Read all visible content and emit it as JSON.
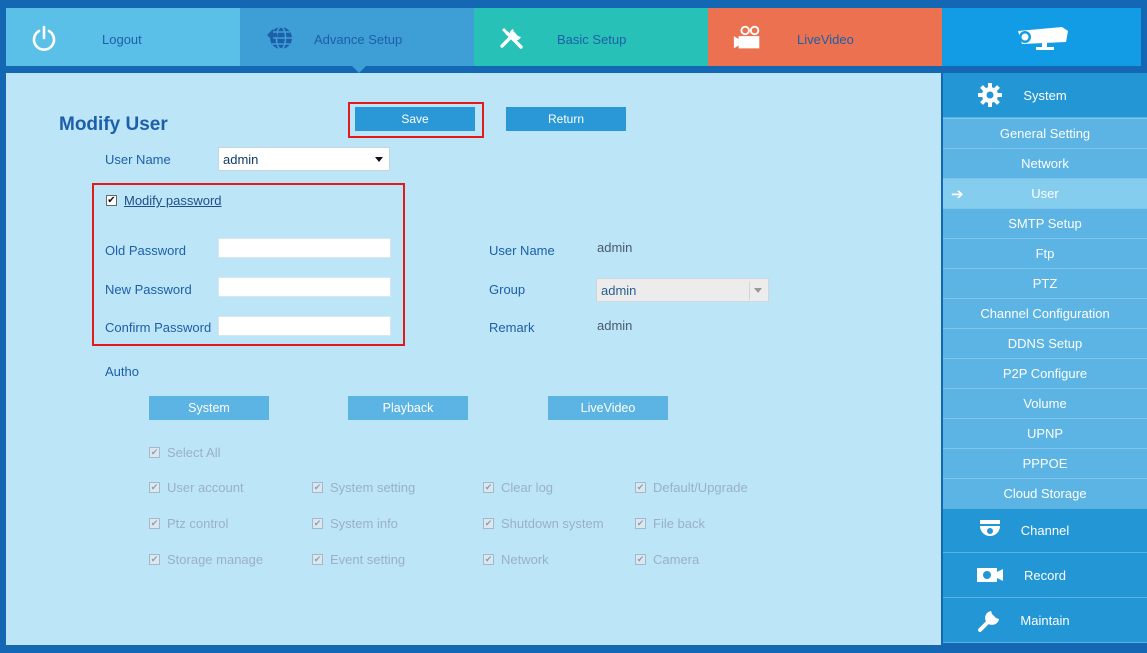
{
  "topnav": {
    "tabs": [
      {
        "label": "Logout",
        "icon": "power-icon",
        "color": "#5bc0e8"
      },
      {
        "label": "Advance Setup",
        "icon": "globe-icon",
        "color": "#3d9fd6"
      },
      {
        "label": "Basic Setup",
        "icon": "tools-icon",
        "color": "#27c1b8"
      },
      {
        "label": "LiveVideo",
        "icon": "video-camera-icon",
        "color": "#ec7150"
      }
    ],
    "logo_icon": "security-camera-icon"
  },
  "page": {
    "title": "Modify User",
    "save_label": "Save",
    "return_label": "Return",
    "username_label": "User Name",
    "username_value": "admin",
    "modify_password_label": "Modify password",
    "modify_password_checked": true,
    "old_password_label": "Old Password",
    "new_password_label": "New Password",
    "confirm_password_label": "Confirm Password",
    "old_password_value": "",
    "new_password_value": "",
    "confirm_password_value": "",
    "info": {
      "user_name_label": "User Name",
      "user_name_value": "admin",
      "group_label": "Group",
      "group_value": "admin",
      "remark_label": "Remark",
      "remark_value": "admin"
    },
    "autho_label": "Autho",
    "autho_tabs": [
      "System",
      "Playback",
      "LiveVideo"
    ],
    "select_all_label": "Select All",
    "permissions": [
      [
        "User account",
        "System setting",
        "Clear log",
        "Default/Upgrade"
      ],
      [
        "Ptz control",
        "System info",
        "Shutdown system",
        "File back"
      ],
      [
        "Storage manage",
        "Event setting",
        "Network",
        "Camera"
      ]
    ],
    "highlight_color": "#e11b1b"
  },
  "sidebar": {
    "system_label": "System",
    "items": [
      "General Setting",
      "Network",
      "User",
      "SMTP Setup",
      "Ftp",
      "PTZ",
      "Channel Configuration",
      "DDNS Setup",
      "P2P Configure",
      "Volume",
      "UPNP",
      "PPPOE",
      "Cloud Storage"
    ],
    "active_item": "User",
    "channel_label": "Channel",
    "record_label": "Record",
    "maintain_label": "Maintain"
  }
}
